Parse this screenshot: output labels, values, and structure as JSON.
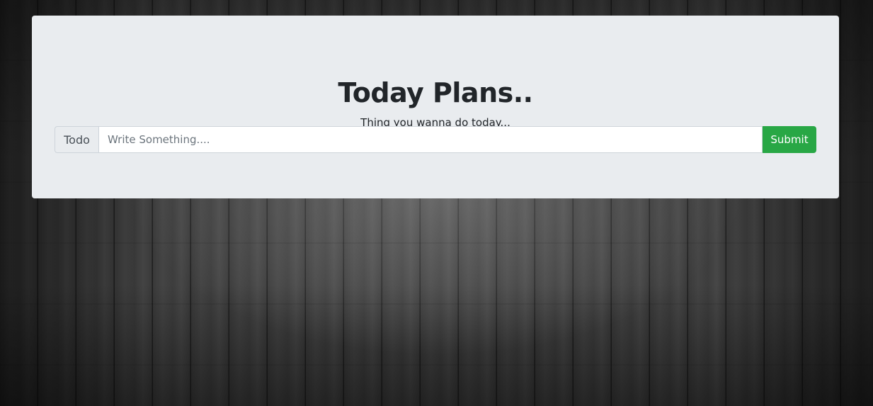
{
  "header": {
    "title": "Today Plans..",
    "subtitle": "Thing you wanna do today..."
  },
  "form": {
    "prefix_label": "Todo",
    "input_value": "",
    "input_placeholder": "Write Something....",
    "submit_label": "Submit"
  },
  "colors": {
    "panel_background": "#e9ecef",
    "submit_green": "#28a745",
    "text_dark": "#212529"
  }
}
